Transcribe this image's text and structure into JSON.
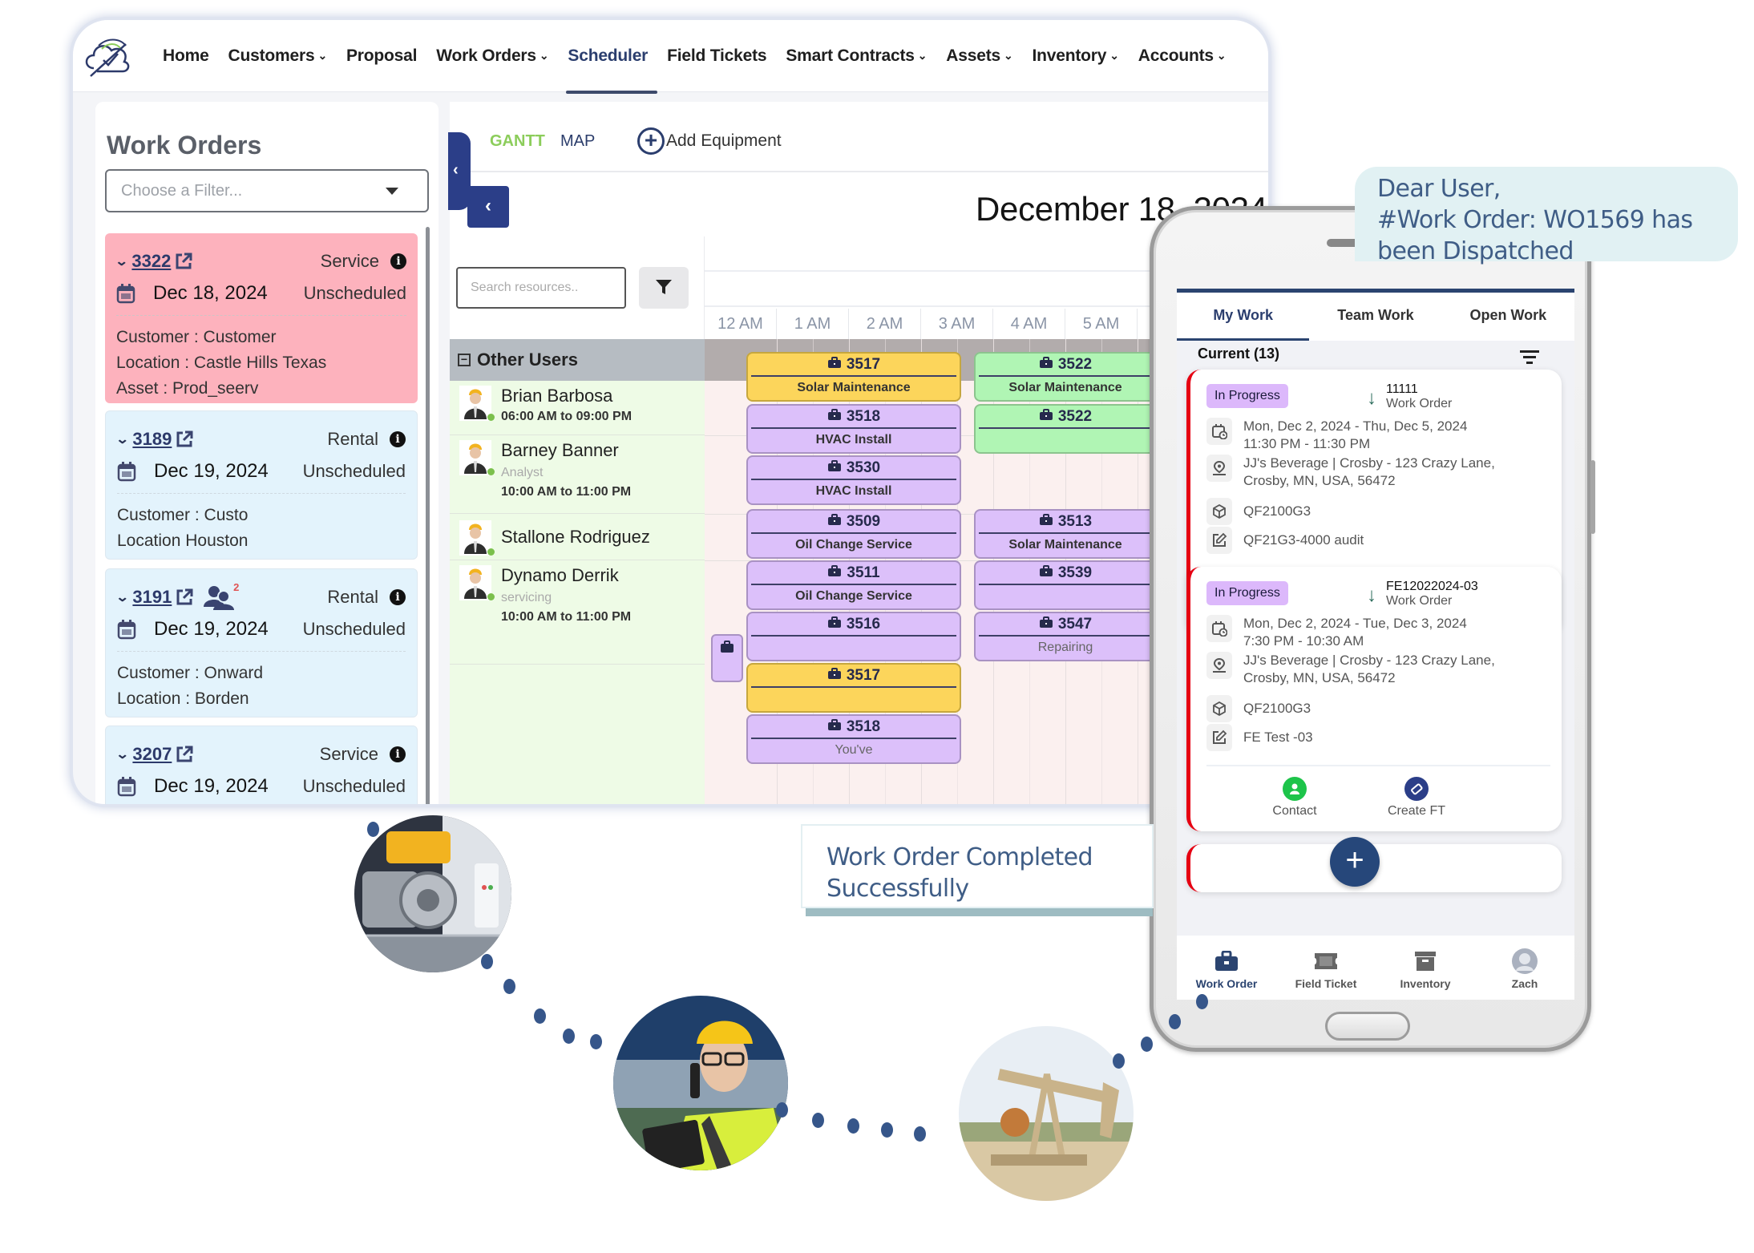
{
  "nav": {
    "items": [
      {
        "label": "Home",
        "dropdown": false
      },
      {
        "label": "Customers",
        "dropdown": true
      },
      {
        "label": "Proposal",
        "dropdown": false
      },
      {
        "label": "Work Orders",
        "dropdown": true
      },
      {
        "label": "Scheduler",
        "dropdown": false,
        "active": true
      },
      {
        "label": "Field Tickets",
        "dropdown": false
      },
      {
        "label": "Smart Contracts",
        "dropdown": true
      },
      {
        "label": "Assets",
        "dropdown": true
      },
      {
        "label": "Inventory",
        "dropdown": true
      },
      {
        "label": "Accounts",
        "dropdown": true
      }
    ],
    "chevron": "⌄"
  },
  "work_orders": {
    "title": "Work Orders",
    "filter_placeholder": "Choose a Filter...",
    "cards": [
      {
        "id": "3322",
        "type": "Service",
        "date": "Dec 18, 2024",
        "status": "Unscheduled",
        "color": "red",
        "details": [
          "Customer : Customer",
          "Location :   Castle Hills Texas",
          "Asset : Prod_seerv"
        ]
      },
      {
        "id": "3189",
        "type": "Rental",
        "date": "Dec 19, 2024",
        "status": "Unscheduled",
        "color": "blue",
        "details": [
          "Customer : Custo",
          "Location  Houston"
        ]
      },
      {
        "id": "3191",
        "type": "Rental",
        "date": "Dec 19, 2024",
        "status": "Unscheduled",
        "color": "blue",
        "team_count": "2",
        "details": [
          "Customer : Onward",
          "Location : Borden"
        ]
      },
      {
        "id": "3207",
        "type": "Service",
        "date": "Dec 19, 2024",
        "status": "Unscheduled",
        "color": "blue",
        "details": []
      }
    ]
  },
  "gantt": {
    "tabs": {
      "gantt": "GANTT",
      "map": "MAP"
    },
    "add_equipment": "Add Equipment",
    "back_label": "‹",
    "date": "December 18, 2024",
    "search_placeholder": "Search resources..",
    "group": "Other Users",
    "hours": [
      "12 AM",
      "1 AM",
      "2 AM",
      "3 AM",
      "4 AM",
      "5 AM"
    ],
    "resources": [
      {
        "name": "Brian Barbosa",
        "role": "",
        "time": "06:00 AM to 09:00 PM"
      },
      {
        "name": "Barney Banner",
        "role": "Analyst",
        "time": "10:00 AM to 11:00 PM"
      },
      {
        "name": "Stallone Rodriguez",
        "role": "",
        "time": ""
      },
      {
        "name": "Dynamo Derrik",
        "role": "servicing",
        "time": "10:00 AM to 11:00 PM"
      }
    ],
    "events": [
      {
        "id": "3517",
        "label": "Solar Maintenance",
        "color": "yellow",
        "col": 0,
        "row": 0
      },
      {
        "id": "3522",
        "label": "Solar Maintenance",
        "color": "green",
        "col": 1,
        "row": 0
      },
      {
        "id": "3518",
        "label": "HVAC Install",
        "color": "purple",
        "col": 0,
        "row": 1
      },
      {
        "id": "3522",
        "label": "",
        "color": "green",
        "col": 1,
        "row": 1
      },
      {
        "id": "3530",
        "label": "HVAC Install",
        "color": "purple",
        "col": 0,
        "row": 2
      },
      {
        "id": "3509",
        "label": "Oil Change Service",
        "color": "purple",
        "col": 0,
        "row": 3
      },
      {
        "id": "3513",
        "label": "Solar Maintenance",
        "color": "purple",
        "col": 1,
        "row": 3
      },
      {
        "id": "3511",
        "label": "Oil Change Service",
        "color": "purple",
        "col": 0,
        "row": 4
      },
      {
        "id": "3539",
        "label": "",
        "color": "purple",
        "col": 1,
        "row": 4
      },
      {
        "id": "3516",
        "label": "",
        "color": "purple",
        "col": 0,
        "row": 5
      },
      {
        "id": "3547",
        "label": "Repairing",
        "color": "purple",
        "col": 1,
        "row": 5,
        "muted": true
      },
      {
        "id": "3517",
        "label": "",
        "color": "yellow",
        "col": 0,
        "row": 6
      },
      {
        "id": "3518",
        "label": "You've",
        "color": "purple",
        "col": 0,
        "row": 7,
        "muted": true
      }
    ]
  },
  "phone": {
    "tabs": [
      "My Work",
      "Team Work",
      "Open Work"
    ],
    "active_tab": "My Work",
    "current_label": "Current (13)",
    "cards": [
      {
        "status": "In Progress",
        "ref_id": "11111",
        "ref_type": "Work Order",
        "dates": "Mon, Dec 2, 2024 - Thu, Dec 5, 2024",
        "times": "11:30 PM - 11:30 PM",
        "address1": "JJ's Beverage | Crosby - 123 Crazy Lane,",
        "address2": "Crosby, MN, USA, 56472",
        "asset": "QF2100G3",
        "note": "QF21G3-4000 audit",
        "action_contact": "Contact",
        "action_create": "Create FT"
      },
      {
        "status": "In Progress",
        "ref_id": "FE12022024-03",
        "ref_type": "Work Order",
        "dates": "Mon, Dec 2, 2024 - Tue, Dec 3, 2024",
        "times": "7:30 PM - 10:30 AM",
        "address1": "JJ's Beverage | Crosby - 123 Crazy Lane,",
        "address2": "Crosby, MN, USA, 56472",
        "asset": "QF2100G3",
        "note": "FE Test -03",
        "action_contact": "Contact",
        "action_create": "Create FT"
      }
    ],
    "fab": "+",
    "bottom_nav": [
      "Work Order",
      "Field Ticket",
      "Inventory",
      "Zach"
    ],
    "active_nav": "Work Order"
  },
  "notifications": {
    "bubble": [
      "Dear User,",
      "#Work Order: WO1569 has",
      "been Dispatched"
    ],
    "toast": [
      "Work Order Completed",
      "Successfully"
    ]
  },
  "colors": {
    "brand_navy": "#2b3e88",
    "accent_green": "#8ccd5b",
    "wo_red": "#fdb2bd",
    "wo_blue": "#e3f3fc",
    "event_purple": "#dcc0fa",
    "event_yellow": "#fcd55b",
    "event_green": "#b0f5b4",
    "in_progress": "#dcb8fb",
    "dots": "#36568a"
  },
  "photos": [
    {
      "subject": "industrial-motor-equipment"
    },
    {
      "subject": "engineer-with-tablet-on-phone"
    },
    {
      "subject": "oil-pumpjack"
    }
  ]
}
